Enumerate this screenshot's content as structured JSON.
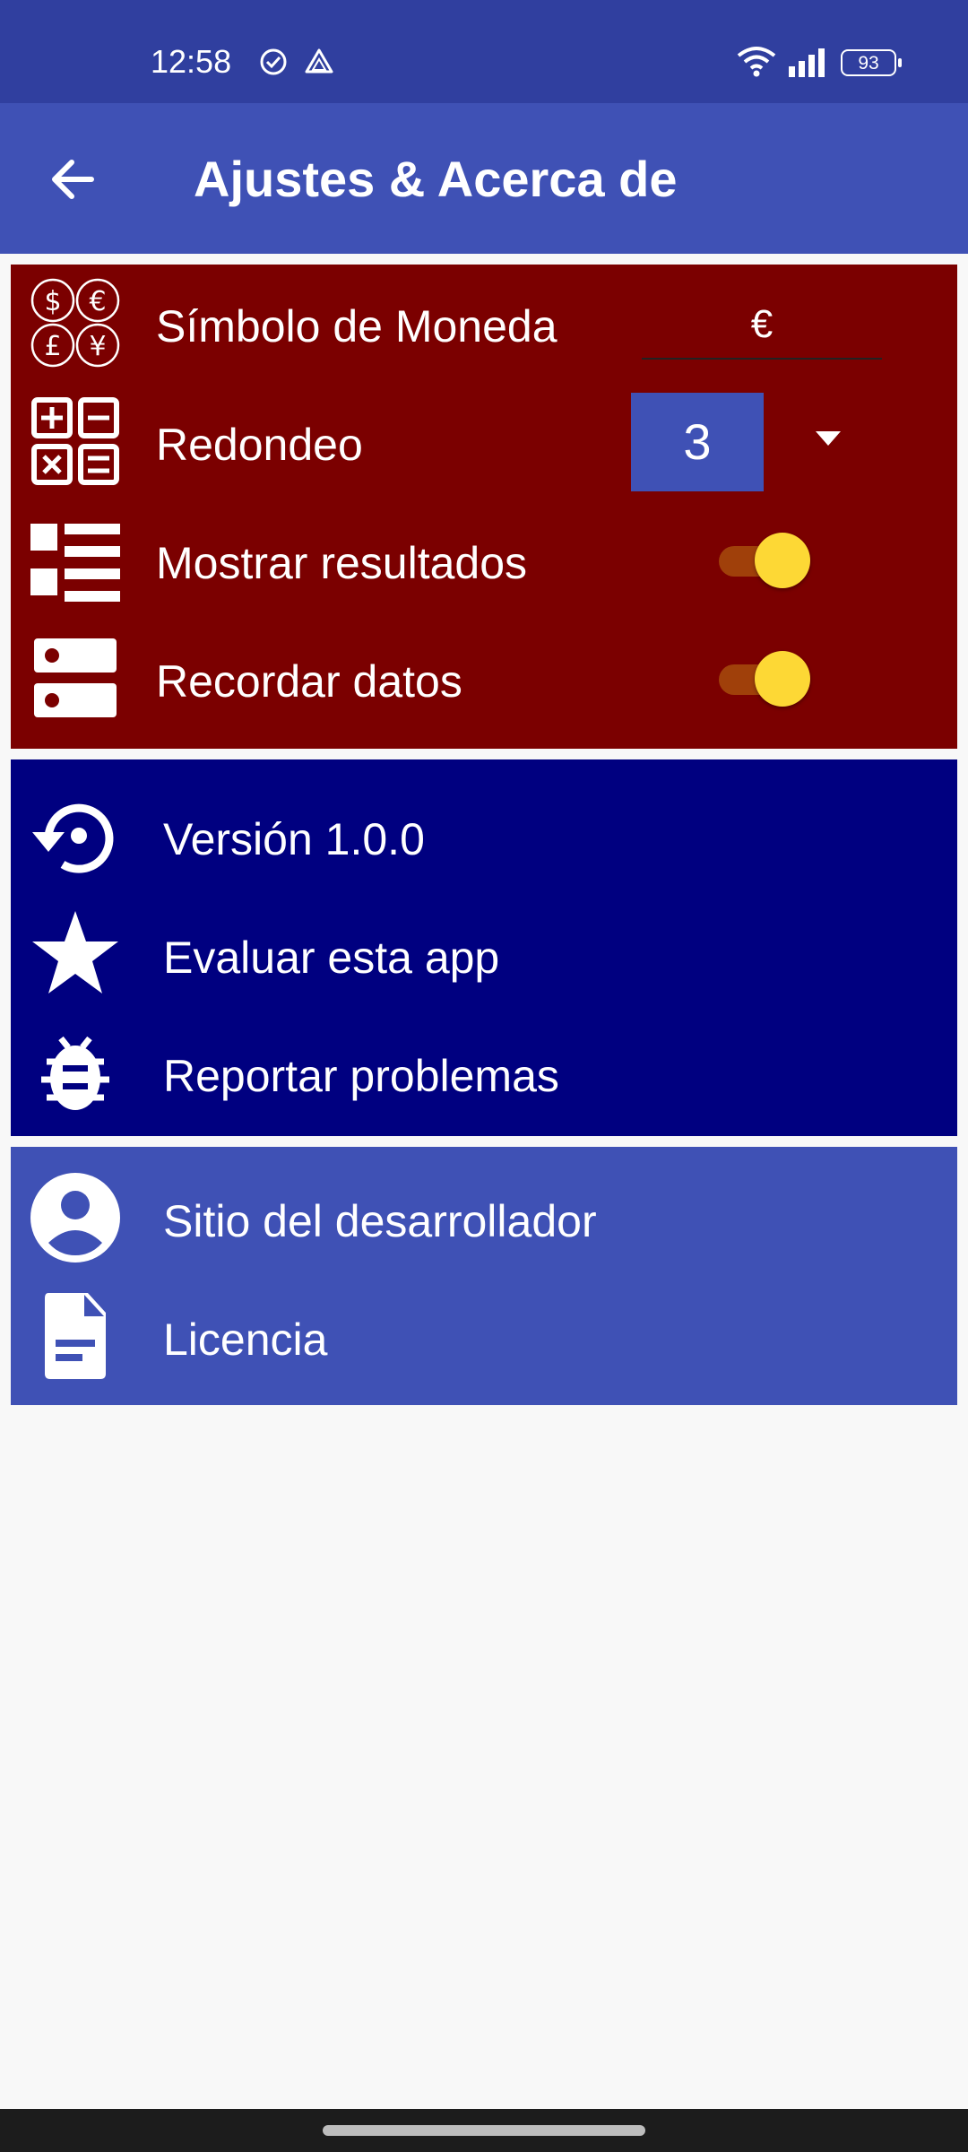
{
  "status_bar": {
    "time": "12:58",
    "battery": "93",
    "icons": [
      "check-circle-icon",
      "drive-icon",
      "wifi-icon",
      "signal-icon",
      "battery-icon"
    ]
  },
  "app_bar": {
    "title": "Ajustes & Acerca de",
    "back_icon": "arrow-left-icon"
  },
  "settings": {
    "currency": {
      "label": "Símbolo de Moneda",
      "value": "€",
      "icon": "currency-symbols-icon"
    },
    "rounding": {
      "label": "Redondeo",
      "value": "3",
      "icon": "calculator-icon"
    },
    "show_results": {
      "label": "Mostrar resultados",
      "enabled": true,
      "icon": "list-icon"
    },
    "remember_data": {
      "label": "Recordar datos",
      "enabled": true,
      "icon": "storage-icon"
    }
  },
  "info": {
    "version": {
      "label": "Versión 1.0.0",
      "icon": "restore-icon"
    },
    "rate": {
      "label": "Evaluar esta app",
      "icon": "star-icon"
    },
    "report": {
      "label": "Reportar problemas",
      "icon": "bug-icon"
    }
  },
  "developer": {
    "site": {
      "label": "Sitio del desarrollador",
      "icon": "account-circle-icon"
    },
    "license": {
      "label": "Licencia",
      "icon": "document-icon"
    }
  },
  "colors": {
    "status_bar": "#303f9f",
    "app_bar": "#3f51b5",
    "settings_card": "#7b0000",
    "info_card": "#000080",
    "developer_card": "#3f51b5",
    "toggle_thumb": "#fdd835",
    "toggle_track": "#a0400a"
  }
}
